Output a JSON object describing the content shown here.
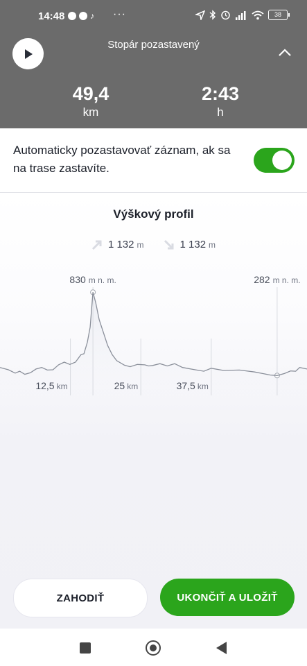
{
  "status_bar": {
    "time": "14:48",
    "more": "···",
    "battery": "38",
    "icons_left": [
      "messenger-icon",
      "chat-icon",
      "tiktok-icon"
    ],
    "icons_right": [
      "location-icon",
      "bluetooth-icon",
      "alarm-icon",
      "signal-icon",
      "wifi-icon",
      "battery-icon"
    ]
  },
  "header": {
    "title": "Stopár pozastavený",
    "distance": {
      "value": "49,4",
      "unit": "km"
    },
    "duration": {
      "value": "2:43",
      "unit": "h"
    },
    "icons": {
      "play": "play-icon",
      "collapse": "chevron-up-icon"
    }
  },
  "auto_pause": {
    "text": "Automaticky pozastavovať záznam, ak sa na trase zastavíte.",
    "enabled": true
  },
  "profile": {
    "title": "Výškový profil",
    "ascent": {
      "value": "1 132",
      "unit": "m",
      "icon": "ascent-arrow-icon"
    },
    "descent": {
      "value": "1 132",
      "unit": "m",
      "icon": "descent-arrow-icon"
    }
  },
  "chart_data": {
    "type": "area",
    "title": "Výškový profil",
    "x_unit": "km",
    "x_ticks": [
      {
        "value": 12.5,
        "label": "12,5",
        "unit": "km"
      },
      {
        "value": 25,
        "label": "25",
        "unit": "km"
      },
      {
        "value": 37.5,
        "label": "37,5",
        "unit": "km"
      }
    ],
    "max_marker": {
      "label": "830",
      "unit": "m n. m.",
      "x": 16.5
    },
    "min_marker": {
      "label": "282",
      "unit": "m n. m.",
      "x": 49.2
    },
    "xlim": [
      0,
      54.5
    ],
    "ylim": [
      160,
      1000
    ],
    "line_color": "#8a8f9a",
    "points": [
      [
        0,
        335
      ],
      [
        1.5,
        320
      ],
      [
        2.7,
        298
      ],
      [
        3.5,
        310
      ],
      [
        4.4,
        290
      ],
      [
        5.4,
        300
      ],
      [
        6.4,
        325
      ],
      [
        7.4,
        335
      ],
      [
        8.4,
        318
      ],
      [
        9.4,
        320
      ],
      [
        10.4,
        352
      ],
      [
        11.4,
        370
      ],
      [
        12.4,
        355
      ],
      [
        13.4,
        370
      ],
      [
        14.4,
        420
      ],
      [
        14.9,
        425
      ],
      [
        15.5,
        500
      ],
      [
        16.0,
        600
      ],
      [
        16.5,
        830
      ],
      [
        17.0,
        760
      ],
      [
        17.6,
        650
      ],
      [
        18.4,
        560
      ],
      [
        19.1,
        480
      ],
      [
        19.9,
        420
      ],
      [
        20.7,
        380
      ],
      [
        22.1,
        350
      ],
      [
        23.1,
        340
      ],
      [
        24.4,
        355
      ],
      [
        25.7,
        352
      ],
      [
        26.4,
        345
      ],
      [
        27.1,
        348
      ],
      [
        28.4,
        360
      ],
      [
        29.7,
        345
      ],
      [
        31.0,
        360
      ],
      [
        32.4,
        335
      ],
      [
        34.3,
        322
      ],
      [
        36.2,
        310
      ],
      [
        37.5,
        330
      ],
      [
        39.7,
        315
      ],
      [
        42.5,
        318
      ],
      [
        45.2,
        305
      ],
      [
        48.0,
        285
      ],
      [
        49.2,
        282
      ],
      [
        50.5,
        295
      ],
      [
        51.6,
        312
      ],
      [
        52.5,
        310
      ],
      [
        53.2,
        335
      ],
      [
        54.5,
        325
      ]
    ]
  },
  "actions": {
    "discard": "ZAHODIŤ",
    "save": "UKONČIŤ A ULOŽIŤ"
  },
  "nav": [
    "recents-button",
    "home-button",
    "back-button"
  ]
}
